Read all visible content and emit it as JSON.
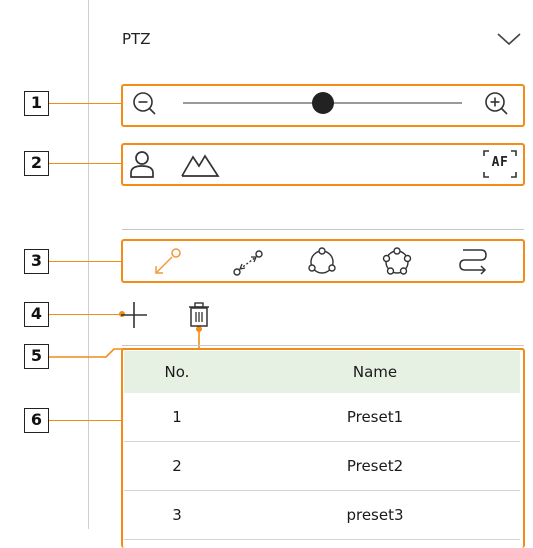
{
  "panel": {
    "title": "PTZ",
    "collapse_icon": "chevron-down-icon"
  },
  "callouts": [
    "1",
    "2",
    "3",
    "4",
    "5",
    "6"
  ],
  "zoom": {
    "out_icon": "zoom-out-icon",
    "in_icon": "zoom-in-icon",
    "slider_value": 0.5
  },
  "focus": {
    "near_icon": "person-icon",
    "far_icon": "mountain-icon",
    "af_label": "AF"
  },
  "modes": [
    {
      "icon": "preset-pointer-icon",
      "active": true
    },
    {
      "icon": "swing-icon",
      "active": false
    },
    {
      "icon": "group-icon",
      "active": false
    },
    {
      "icon": "tour-icon",
      "active": false
    },
    {
      "icon": "trace-icon",
      "active": false
    }
  ],
  "actions": {
    "add_icon": "plus-icon",
    "delete_icon": "trash-icon"
  },
  "table": {
    "headers": [
      "No.",
      "Name"
    ],
    "rows": [
      {
        "no": "1",
        "name": "Preset1"
      },
      {
        "no": "2",
        "name": "Preset2"
      },
      {
        "no": "3",
        "name": "preset3"
      }
    ]
  },
  "colors": {
    "callout": "#f28c16",
    "header_bg": "#e6f1e4",
    "accent": "#f09a3a"
  }
}
